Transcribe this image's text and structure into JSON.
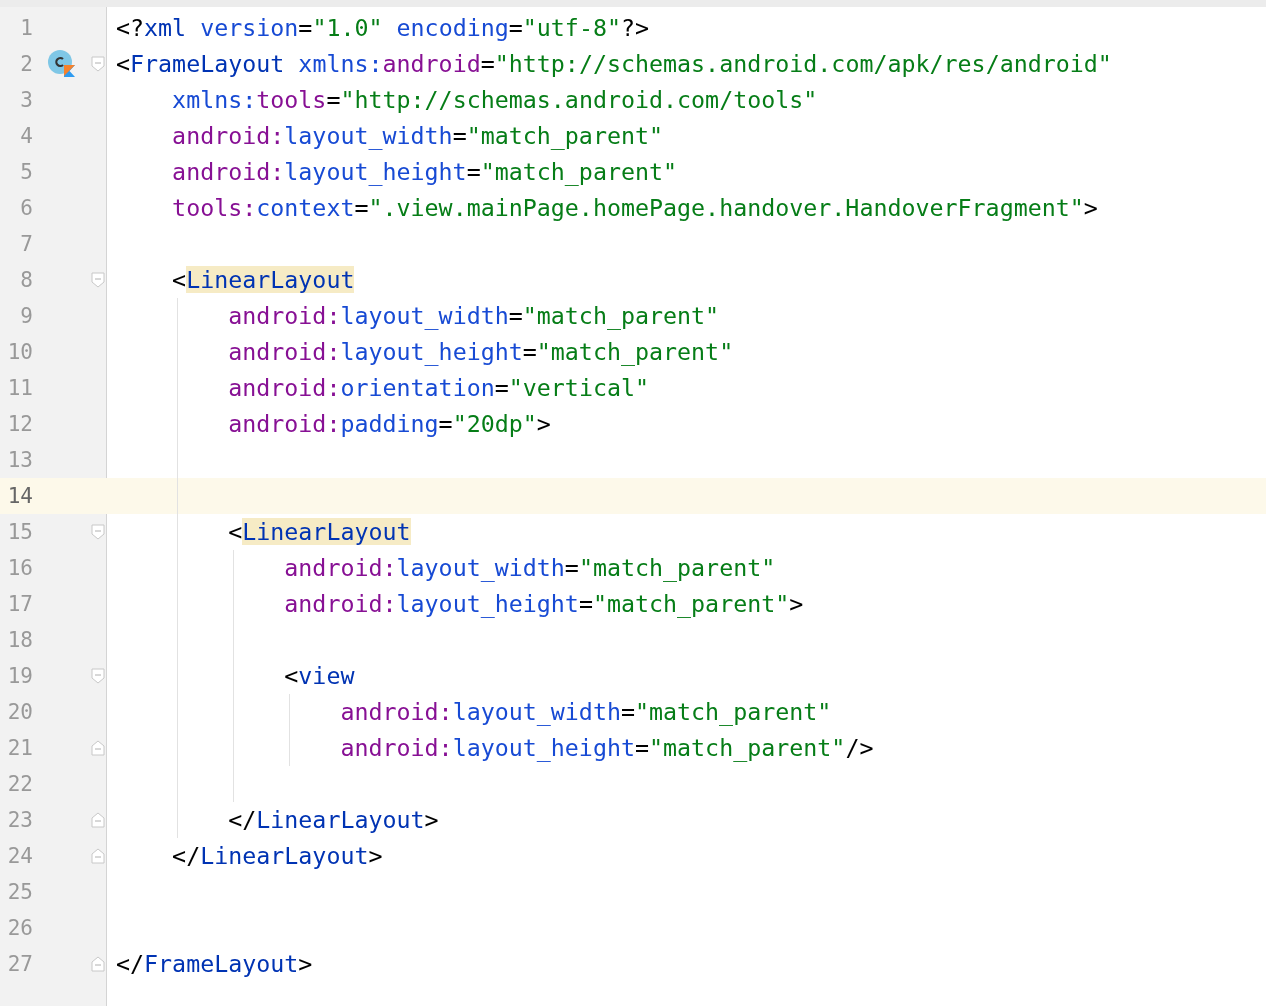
{
  "editor": {
    "lines": [
      {
        "number": "1",
        "current": false,
        "tokens": [
          {
            "kind": "punct",
            "text": "<?"
          },
          {
            "kind": "tag",
            "text": "xml"
          },
          {
            "kind": "attr",
            "text": " version"
          },
          {
            "kind": "punct",
            "text": "="
          },
          {
            "kind": "value",
            "text": "\"1.0\""
          },
          {
            "kind": "attr",
            "text": " encoding"
          },
          {
            "kind": "punct",
            "text": "="
          },
          {
            "kind": "value",
            "text": "\"utf-8\""
          },
          {
            "kind": "punct",
            "text": "?>"
          }
        ]
      },
      {
        "number": "2",
        "current": false,
        "gutter_icon": {
          "kind": "kotlin-class"
        },
        "fold": {
          "kind": "start"
        },
        "tokens": [
          {
            "kind": "punct",
            "text": "<"
          },
          {
            "kind": "tag",
            "text": "FrameLayout"
          },
          {
            "kind": "attr",
            "text": " xmlns:"
          },
          {
            "kind": "ns",
            "text": "android"
          },
          {
            "kind": "punct",
            "text": "="
          },
          {
            "kind": "value",
            "text": "\"http://schemas.android.com/apk/res/android\""
          }
        ]
      },
      {
        "number": "3",
        "current": false,
        "tokens": [
          {
            "kind": "attr",
            "text": "    xmlns:"
          },
          {
            "kind": "ns",
            "text": "tools"
          },
          {
            "kind": "punct",
            "text": "="
          },
          {
            "kind": "value",
            "text": "\"http://schemas.android.com/tools\""
          }
        ]
      },
      {
        "number": "4",
        "current": false,
        "tokens": [
          {
            "kind": "ns",
            "text": "    android:"
          },
          {
            "kind": "attr",
            "text": "layout_width"
          },
          {
            "kind": "punct",
            "text": "="
          },
          {
            "kind": "value",
            "text": "\"match_parent\""
          }
        ]
      },
      {
        "number": "5",
        "current": false,
        "tokens": [
          {
            "kind": "ns",
            "text": "    android:"
          },
          {
            "kind": "attr",
            "text": "layout_height"
          },
          {
            "kind": "punct",
            "text": "="
          },
          {
            "kind": "value",
            "text": "\"match_parent\""
          }
        ]
      },
      {
        "number": "6",
        "current": false,
        "tokens": [
          {
            "kind": "ns",
            "text": "    tools:"
          },
          {
            "kind": "attr",
            "text": "context"
          },
          {
            "kind": "punct",
            "text": "="
          },
          {
            "kind": "value",
            "text": "\".view.mainPage.homePage.handover.HandoverFragment\""
          },
          {
            "kind": "punct",
            "text": ">"
          }
        ]
      },
      {
        "number": "7",
        "current": false
      },
      {
        "number": "8",
        "current": false,
        "fold": {
          "kind": "start"
        },
        "tokens": [
          {
            "kind": "punct",
            "text": "    <"
          },
          {
            "kind": "tag-match",
            "text": "LinearLayout"
          }
        ]
      },
      {
        "number": "9",
        "current": false,
        "tokens": [
          {
            "kind": "ns",
            "text": "        android:"
          },
          {
            "kind": "attr",
            "text": "layout_width"
          },
          {
            "kind": "punct",
            "text": "="
          },
          {
            "kind": "value",
            "text": "\"match_parent\""
          }
        ]
      },
      {
        "number": "10",
        "current": false,
        "tokens": [
          {
            "kind": "ns",
            "text": "        android:"
          },
          {
            "kind": "attr",
            "text": "layout_height"
          },
          {
            "kind": "punct",
            "text": "="
          },
          {
            "kind": "value",
            "text": "\"match_parent\""
          }
        ]
      },
      {
        "number": "11",
        "current": false,
        "tokens": [
          {
            "kind": "ns",
            "text": "        android:"
          },
          {
            "kind": "attr",
            "text": "orientation"
          },
          {
            "kind": "punct",
            "text": "="
          },
          {
            "kind": "value",
            "text": "\"vertical\""
          }
        ]
      },
      {
        "number": "12",
        "current": false,
        "tokens": [
          {
            "kind": "ns",
            "text": "        android:"
          },
          {
            "kind": "attr",
            "text": "padding"
          },
          {
            "kind": "punct",
            "text": "="
          },
          {
            "kind": "value",
            "text": "\"20dp\""
          },
          {
            "kind": "punct",
            "text": ">"
          }
        ]
      },
      {
        "number": "13",
        "current": false
      },
      {
        "number": "14",
        "current": true
      },
      {
        "number": "15",
        "current": false,
        "fold": {
          "kind": "start"
        },
        "tokens": [
          {
            "kind": "punct",
            "text": "        <"
          },
          {
            "kind": "tag-match",
            "text": "LinearLayout"
          }
        ]
      },
      {
        "number": "16",
        "current": false,
        "tokens": [
          {
            "kind": "ns",
            "text": "            android:"
          },
          {
            "kind": "attr",
            "text": "layout_width"
          },
          {
            "kind": "punct",
            "text": "="
          },
          {
            "kind": "value",
            "text": "\"match_parent\""
          }
        ]
      },
      {
        "number": "17",
        "current": false,
        "tokens": [
          {
            "kind": "ns",
            "text": "            android:"
          },
          {
            "kind": "attr",
            "text": "layout_height"
          },
          {
            "kind": "punct",
            "text": "="
          },
          {
            "kind": "value",
            "text": "\"match_parent\""
          },
          {
            "kind": "punct",
            "text": ">"
          }
        ]
      },
      {
        "number": "18",
        "current": false
      },
      {
        "number": "19",
        "current": false,
        "fold": {
          "kind": "start"
        },
        "tokens": [
          {
            "kind": "punct",
            "text": "            <"
          },
          {
            "kind": "tag",
            "text": "view"
          }
        ]
      },
      {
        "number": "20",
        "current": false,
        "tokens": [
          {
            "kind": "ns",
            "text": "                android:"
          },
          {
            "kind": "attr",
            "text": "layout_width"
          },
          {
            "kind": "punct",
            "text": "="
          },
          {
            "kind": "value",
            "text": "\"match_parent\""
          }
        ]
      },
      {
        "number": "21",
        "current": false,
        "fold": {
          "kind": "end"
        },
        "tokens": [
          {
            "kind": "ns",
            "text": "                android:"
          },
          {
            "kind": "attr",
            "text": "layout_height"
          },
          {
            "kind": "punct",
            "text": "="
          },
          {
            "kind": "value",
            "text": "\"match_parent\""
          },
          {
            "kind": "punct",
            "text": "/>"
          }
        ]
      },
      {
        "number": "22",
        "current": false
      },
      {
        "number": "23",
        "current": false,
        "fold": {
          "kind": "end"
        },
        "tokens": [
          {
            "kind": "punct",
            "text": "        </"
          },
          {
            "kind": "tag",
            "text": "LinearLayout"
          },
          {
            "kind": "punct",
            "text": ">"
          }
        ]
      },
      {
        "number": "24",
        "current": false,
        "fold": {
          "kind": "end"
        },
        "tokens": [
          {
            "kind": "punct",
            "text": "    </"
          },
          {
            "kind": "tag",
            "text": "LinearLayout"
          },
          {
            "kind": "punct",
            "text": ">"
          }
        ]
      },
      {
        "number": "25",
        "current": false
      },
      {
        "number": "26",
        "current": false
      },
      {
        "number": "27",
        "current": false,
        "fold": {
          "kind": "end"
        },
        "tokens": [
          {
            "kind": "punct",
            "text": "</"
          },
          {
            "kind": "tag",
            "text": "FrameLayout"
          },
          {
            "kind": "punct",
            "text": ">"
          }
        ]
      }
    ]
  }
}
